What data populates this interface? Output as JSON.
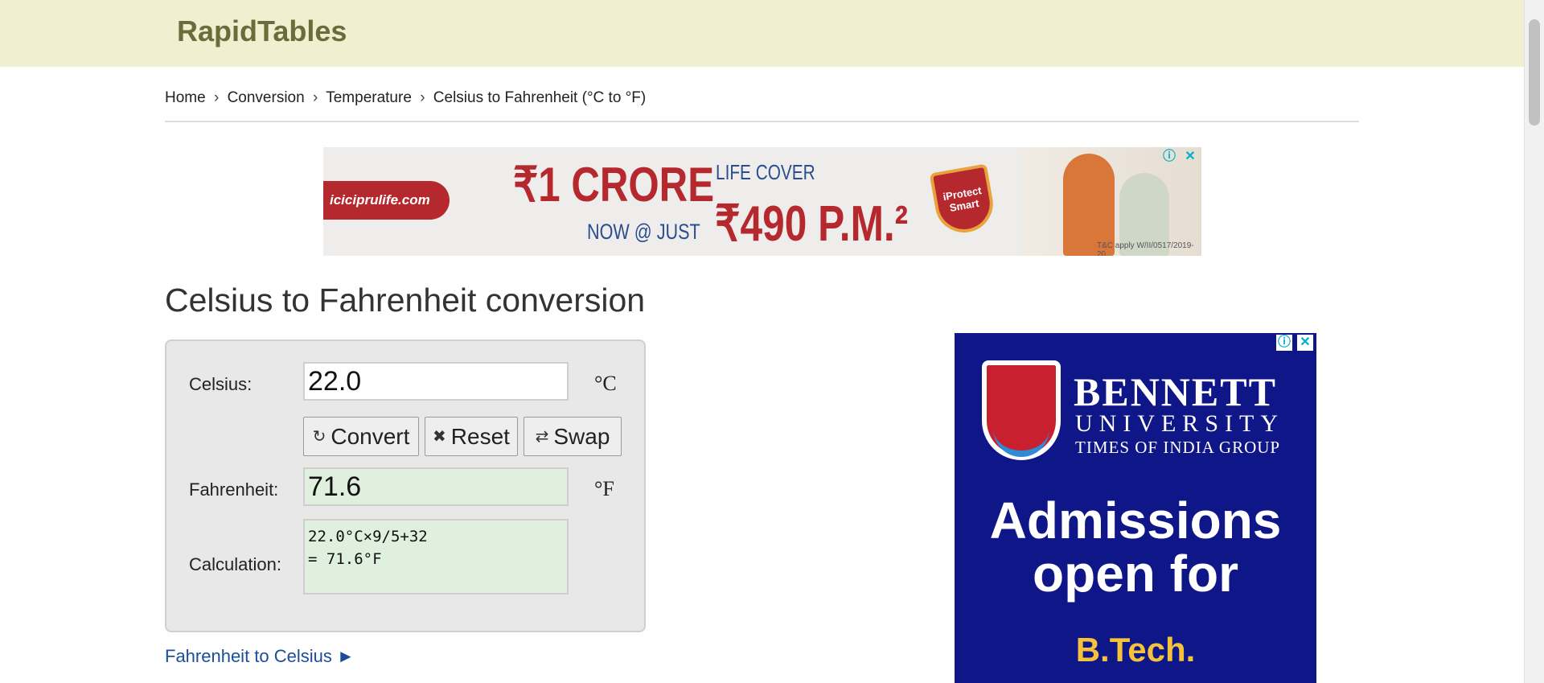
{
  "header": {
    "logo": "RapidTables"
  },
  "breadcrumb": {
    "items": [
      "Home",
      "Conversion",
      "Temperature",
      "Celsius to Fahrenheit (°C to °F)"
    ],
    "separator": "›"
  },
  "ad_top": {
    "site": "iciciprulife.com",
    "headline": "₹1 CRORE",
    "sub": "LIFE COVER",
    "now": "NOW @ JUST",
    "price": "₹490 P.M.²",
    "badge": "iProtect Smart",
    "fine_print": "T&C apply W/II/0517/2019-20",
    "info_icon": "info-icon",
    "close_icon": "close-icon"
  },
  "page_title": "Celsius to Fahrenheit conversion",
  "converter": {
    "celsius_label": "Celsius:",
    "celsius_value": "22.0",
    "celsius_unit": "°C",
    "buttons": {
      "convert": "Convert",
      "reset": "Reset",
      "swap": "Swap"
    },
    "icons": {
      "convert": "refresh-icon",
      "reset": "x-icon",
      "swap": "swap-icon"
    },
    "fahrenheit_label": "Fahrenheit:",
    "fahrenheit_value": "71.6",
    "fahrenheit_unit": "°F",
    "calculation_label": "Calculation:",
    "calculation_value": "22.0°C×9/5+32\n= 71.6°F"
  },
  "links": {
    "reverse": "Fahrenheit to Celsius ►"
  },
  "ad_right": {
    "brand": "BENNETT",
    "university": "UNIVERSITY",
    "group": "TIMES OF INDIA GROUP",
    "headline": "Admissions open for",
    "program": "B.Tech."
  },
  "colors": {
    "header_bg": "#f0efd0",
    "logo": "#6b6b3c",
    "result_bg": "#dff0df",
    "link": "#1a4d9c",
    "ad_right_bg": "#0f1687"
  }
}
